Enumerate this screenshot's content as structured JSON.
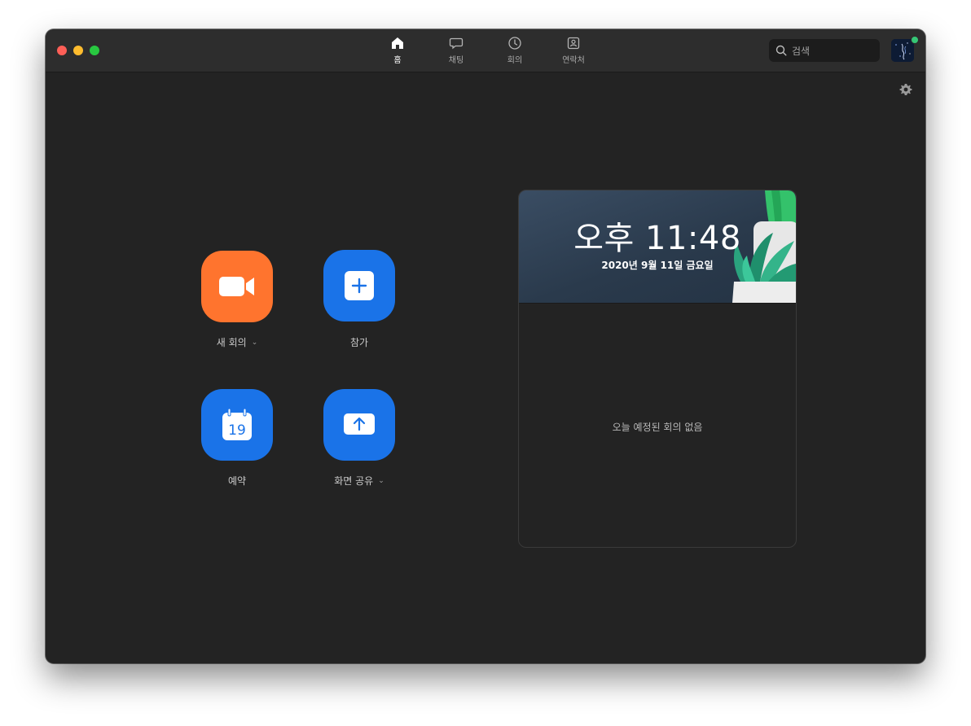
{
  "nav": {
    "tabs": [
      {
        "label": "홈",
        "icon": "home-icon",
        "active": true
      },
      {
        "label": "채팅",
        "icon": "chat-icon",
        "active": false
      },
      {
        "label": "회의",
        "icon": "clock-icon",
        "active": false
      },
      {
        "label": "연락처",
        "icon": "contacts-icon",
        "active": false
      }
    ]
  },
  "search": {
    "placeholder": "검색"
  },
  "profile": {
    "status": "online",
    "status_color": "#36c776"
  },
  "actions": {
    "new_meeting": {
      "label": "새 회의",
      "has_dropdown": true,
      "color": "#ff742e",
      "icon": "video-camera-icon"
    },
    "join": {
      "label": "참가",
      "color": "#1a73e8",
      "icon": "plus-icon"
    },
    "schedule": {
      "label": "예약",
      "calendar_day": "19",
      "color": "#1a73e8",
      "icon": "calendar-icon"
    },
    "share_screen": {
      "label": "화면 공유",
      "has_dropdown": true,
      "color": "#1a73e8",
      "icon": "upload-arrow-icon"
    }
  },
  "agenda": {
    "time": "오후 11:48",
    "date": "2020년 9월 11일 금요일",
    "empty_message": "오늘 예정된 회의 없음"
  },
  "colors": {
    "background": "#232323",
    "titlebar": "#2d2d2d",
    "accent_blue": "#1a73e8",
    "accent_orange": "#ff742e"
  }
}
